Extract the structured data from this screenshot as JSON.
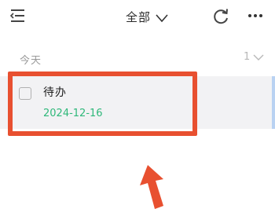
{
  "header": {
    "title": "全部",
    "icons": {
      "menu": "menu-lines-icon",
      "title_dropdown": "chevron-down-icon",
      "sync": "sync-icon",
      "more": "more-dots-icon"
    }
  },
  "section": {
    "label": "今天",
    "count": "1"
  },
  "task": {
    "title": "待办",
    "date": "2024-12-16",
    "checked": false
  },
  "colors": {
    "highlight": "#e85030",
    "date_text": "#2fb87a",
    "card_bg": "#f2f2f4",
    "card_accent": "#b9d2f2"
  }
}
